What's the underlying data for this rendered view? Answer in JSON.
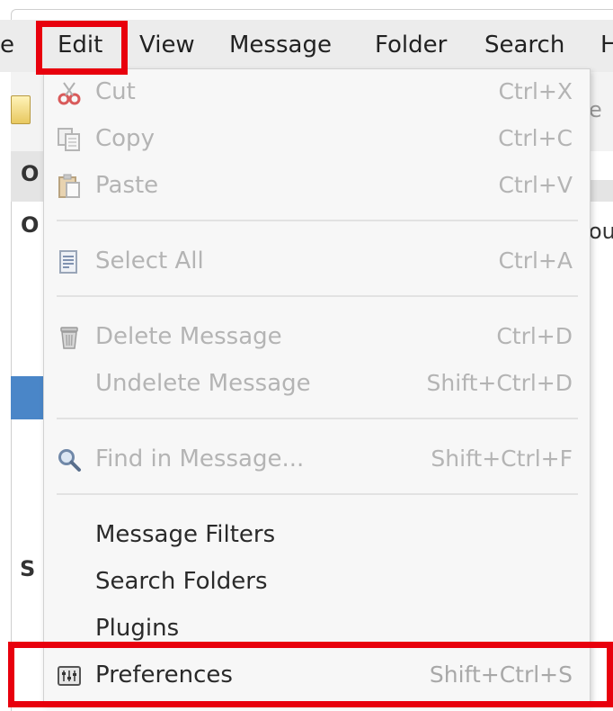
{
  "menubar": {
    "items": [
      {
        "label": "e"
      },
      {
        "label": "Edit"
      },
      {
        "label": "View"
      },
      {
        "label": "Message"
      },
      {
        "label": "Folder"
      },
      {
        "label": "Search"
      },
      {
        "label": "H"
      }
    ]
  },
  "background": {
    "left_fragments": [
      "O",
      "O",
      "S"
    ],
    "right_fragments": [
      "e",
      "ou"
    ]
  },
  "edit_menu": {
    "cut": {
      "label": "Cut",
      "accel": "Ctrl+X",
      "icon": "scissors-icon"
    },
    "copy": {
      "label": "Copy",
      "accel": "Ctrl+C",
      "icon": "copy-icon"
    },
    "paste": {
      "label": "Paste",
      "accel": "Ctrl+V",
      "icon": "paste-icon"
    },
    "select_all": {
      "label": "Select All",
      "accel": "Ctrl+A",
      "icon": "select-all-icon"
    },
    "delete_message": {
      "label": "Delete Message",
      "accel": "Ctrl+D",
      "icon": "trash-icon"
    },
    "undelete_message": {
      "label": "Undelete Message",
      "accel": "Shift+Ctrl+D"
    },
    "find_in_message": {
      "label": "Find in Message...",
      "accel": "Shift+Ctrl+F",
      "icon": "magnifier-icon"
    },
    "message_filters": {
      "label": "Message Filters"
    },
    "search_folders": {
      "label": "Search Folders"
    },
    "plugins": {
      "label": "Plugins"
    },
    "preferences": {
      "label": "Preferences",
      "accel": "Shift+Ctrl+S",
      "icon": "preferences-icon"
    }
  },
  "colors": {
    "highlight": "#e8000d",
    "menu_background": "#f7f7f7",
    "selection_blue": "#4a86c8"
  }
}
